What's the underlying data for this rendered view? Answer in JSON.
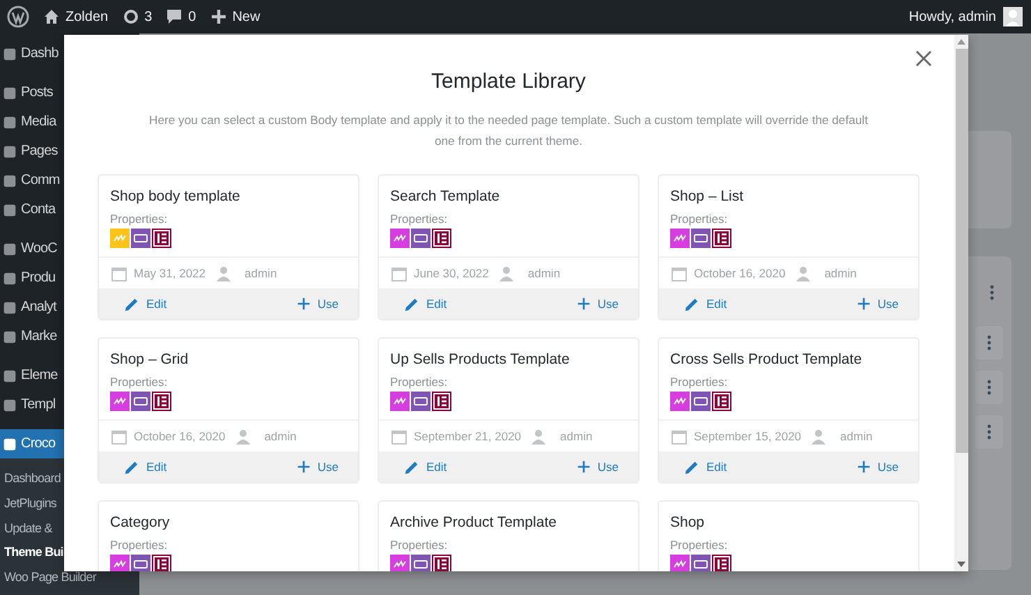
{
  "admin_bar": {
    "site": "Zolden",
    "updates": "3",
    "comments": "0",
    "new": "New",
    "greeting": "Howdy, admin"
  },
  "sidebar": {
    "groups": [
      {
        "items": [
          {
            "label": "Dashb",
            "selected": false
          }
        ]
      },
      {
        "items": [
          {
            "label": "Posts",
            "selected": false
          },
          {
            "label": "Media",
            "selected": false
          },
          {
            "label": "Pages",
            "selected": false
          },
          {
            "label": "Comm",
            "selected": false
          },
          {
            "label": "Conta",
            "selected": false
          }
        ]
      },
      {
        "items": [
          {
            "label": "WooC",
            "selected": false
          },
          {
            "label": "Produ",
            "selected": false
          },
          {
            "label": "Analyt",
            "selected": false
          },
          {
            "label": "Marke",
            "selected": false
          }
        ]
      },
      {
        "items": [
          {
            "label": "Eleme",
            "selected": false
          },
          {
            "label": "Templ",
            "selected": false
          }
        ]
      },
      {
        "items": [
          {
            "label": "Croco",
            "selected": true
          }
        ]
      }
    ],
    "submenu": [
      {
        "label": "Dashboard",
        "selected": false
      },
      {
        "label": "JetPlugins",
        "selected": false
      },
      {
        "label": "Update &",
        "selected": false
      },
      {
        "label": "Theme Bui",
        "selected": true
      },
      {
        "label": "Woo Page Builder",
        "selected": false
      }
    ]
  },
  "modal": {
    "title": "Template Library",
    "description": "Here you can select a custom Body template and apply it to the needed page template. Such a custom template will override the default one from the current theme.",
    "cards": [
      {
        "title": "Shop body template",
        "properties_label": "Properties:",
        "properties": [
          {
            "kind": "jet",
            "color": "#fcc419"
          },
          {
            "kind": "woo",
            "color": "#7f54b3"
          },
          {
            "kind": "elementor",
            "color": "#92003b"
          }
        ],
        "date": "May 31, 2022",
        "author": "admin",
        "edit": "Edit",
        "use": "Use"
      },
      {
        "title": "Search Template",
        "properties_label": "Properties:",
        "properties": [
          {
            "kind": "jet",
            "color": "#d63ee0"
          },
          {
            "kind": "woo",
            "color": "#7f54b3"
          },
          {
            "kind": "elementor",
            "color": "#92003b"
          }
        ],
        "date": "June 30, 2022",
        "author": "admin",
        "edit": "Edit",
        "use": "Use"
      },
      {
        "title": "Shop – List",
        "properties_label": "Properties:",
        "properties": [
          {
            "kind": "jet",
            "color": "#d63ee0"
          },
          {
            "kind": "woo",
            "color": "#7f54b3"
          },
          {
            "kind": "elementor",
            "color": "#92003b"
          }
        ],
        "date": "October 16, 2020",
        "author": "admin",
        "edit": "Edit",
        "use": "Use"
      },
      {
        "title": "Shop – Grid",
        "properties_label": "Properties:",
        "properties": [
          {
            "kind": "jet",
            "color": "#d63ee0"
          },
          {
            "kind": "woo",
            "color": "#7f54b3"
          },
          {
            "kind": "elementor",
            "color": "#92003b"
          }
        ],
        "date": "October 16, 2020",
        "author": "admin",
        "edit": "Edit",
        "use": "Use"
      },
      {
        "title": "Up Sells Products Template",
        "properties_label": "Properties:",
        "properties": [
          {
            "kind": "jet",
            "color": "#d63ee0"
          },
          {
            "kind": "woo",
            "color": "#7f54b3"
          },
          {
            "kind": "elementor",
            "color": "#92003b"
          }
        ],
        "date": "September 21, 2020",
        "author": "admin",
        "edit": "Edit",
        "use": "Use"
      },
      {
        "title": "Cross Sells Product Template",
        "properties_label": "Properties:",
        "properties": [
          {
            "kind": "jet",
            "color": "#d63ee0"
          },
          {
            "kind": "woo",
            "color": "#7f54b3"
          },
          {
            "kind": "elementor",
            "color": "#92003b"
          }
        ],
        "date": "September 15, 2020",
        "author": "admin",
        "edit": "Edit",
        "use": "Use"
      },
      {
        "title": "Category",
        "properties_label": "Properties:",
        "properties": [
          {
            "kind": "jet",
            "color": "#d63ee0"
          },
          {
            "kind": "woo",
            "color": "#7f54b3"
          },
          {
            "kind": "elementor",
            "color": "#92003b"
          }
        ]
      },
      {
        "title": "Archive Product Template",
        "properties_label": "Properties:",
        "properties": [
          {
            "kind": "jet",
            "color": "#d63ee0"
          },
          {
            "kind": "woo",
            "color": "#7f54b3"
          },
          {
            "kind": "elementor",
            "color": "#92003b"
          }
        ]
      },
      {
        "title": "Shop",
        "properties_label": "Properties:",
        "properties": [
          {
            "kind": "jet",
            "color": "#d63ee0"
          },
          {
            "kind": "woo",
            "color": "#7f54b3"
          },
          {
            "kind": "elementor",
            "color": "#92003b"
          }
        ]
      }
    ]
  }
}
